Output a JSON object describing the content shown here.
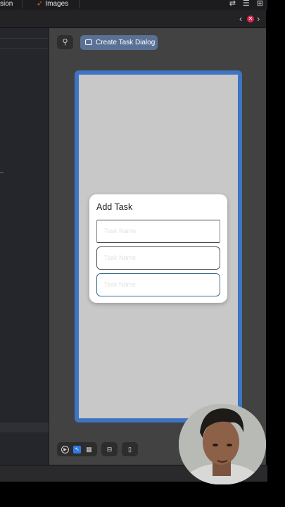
{
  "tabs": {
    "first_label": "sion",
    "second_label": "Images",
    "second_icon": "swift-icon"
  },
  "preview": {
    "pin_icon": "pin-icon",
    "selected_preview_label": "Create Task Dialog"
  },
  "dialog": {
    "title": "Add Task",
    "fields": [
      {
        "placeholder": "Task Name"
      },
      {
        "placeholder": "Task Name"
      },
      {
        "placeholder": "Task Name"
      }
    ]
  },
  "error_count_icon": "error-icon",
  "colors": {
    "device_frame": "#3e74c2",
    "preview_button": "#5a7195",
    "canvas": "#424242",
    "error": "#e0224b"
  }
}
